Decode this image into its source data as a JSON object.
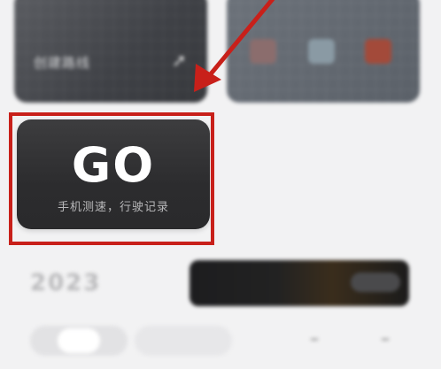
{
  "top_left_card": {
    "label": "创建路线",
    "small_text": "",
    "icon": "arrow-icon"
  },
  "go_card": {
    "title": "GO",
    "subtitle": "手机测速，行驶记录"
  },
  "colors": {
    "highlight": "#c8201a",
    "go_bg": "#2c2c2e"
  }
}
